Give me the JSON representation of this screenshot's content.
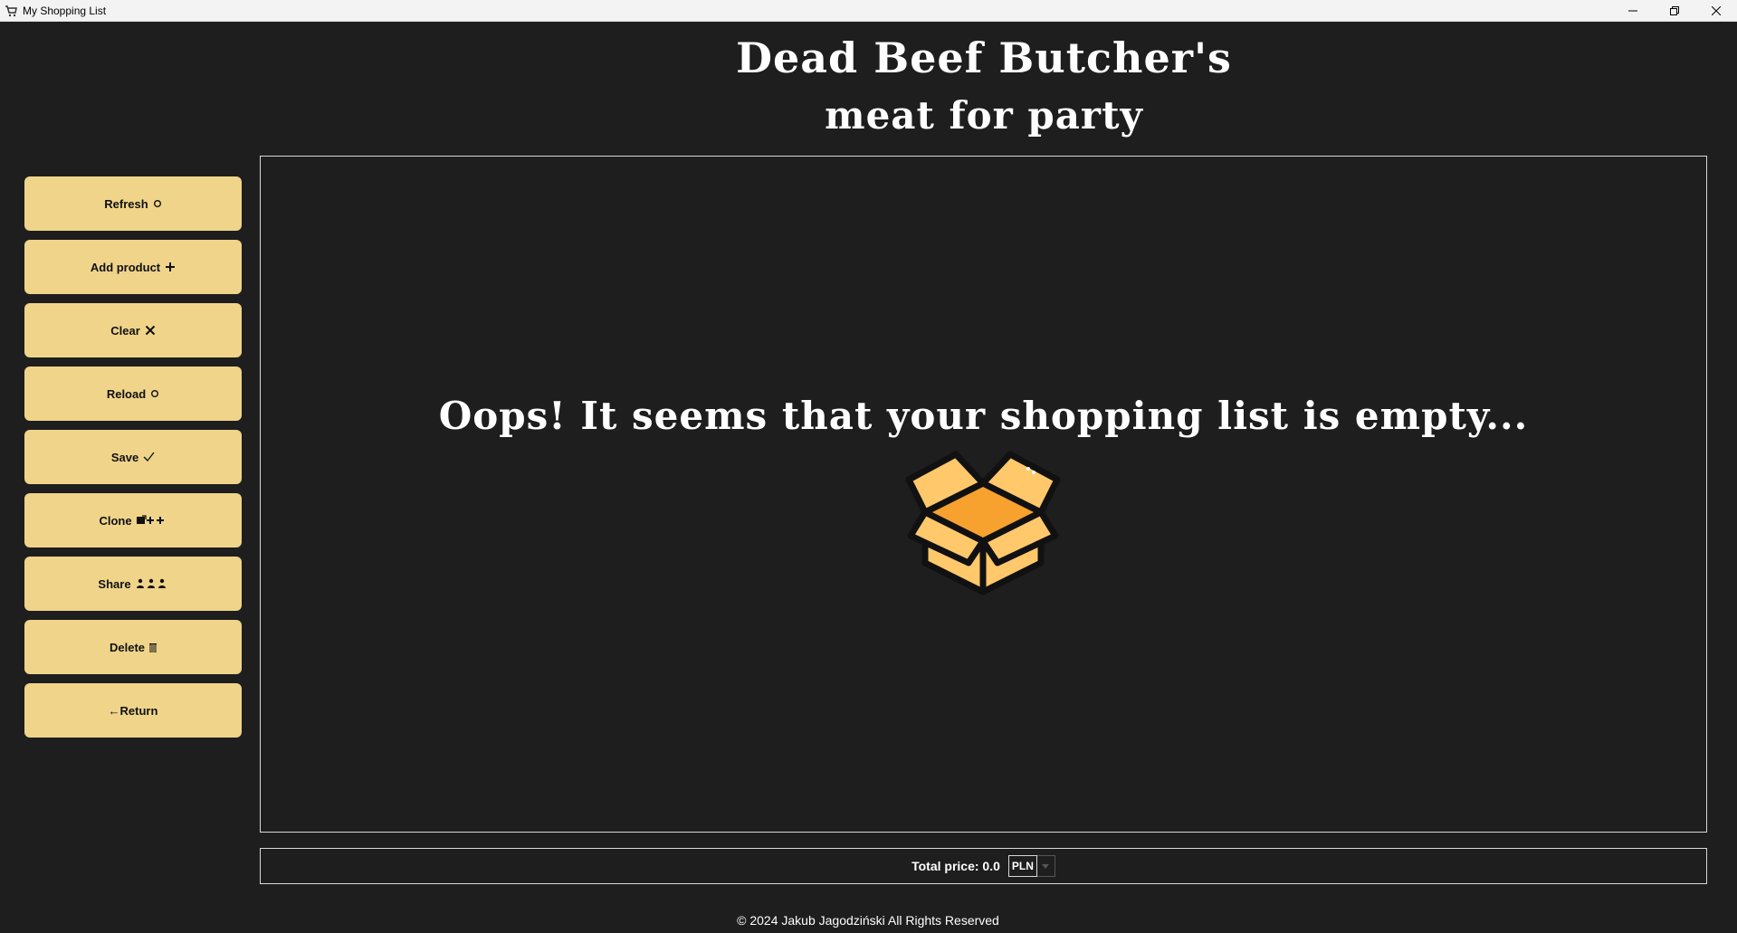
{
  "window": {
    "title": "My Shopping List"
  },
  "header": {
    "line1": "Dead Beef Butcher's",
    "line2": "meat for party"
  },
  "sidebar": {
    "buttons": [
      {
        "label": "Refresh",
        "icon": "refresh-icon"
      },
      {
        "label": "Add product",
        "icon": "plus-icon"
      },
      {
        "label": "Clear",
        "icon": "x-icon"
      },
      {
        "label": "Reload",
        "icon": "reload-icon"
      },
      {
        "label": "Save",
        "icon": "checkmark-icon"
      },
      {
        "label": "Clone",
        "icon": "clone-icon"
      },
      {
        "label": "Share",
        "icon": "people-icon"
      },
      {
        "label": "Delete",
        "icon": "trash-icon"
      },
      {
        "label": "←Return",
        "icon": ""
      }
    ]
  },
  "main": {
    "empty_message": "Oops! It seems that your shopping list is empty..."
  },
  "total": {
    "label": "Total price: 0.0",
    "currency": "PLN"
  },
  "footer": {
    "text": "© 2024 Jakub Jagodziński All Rights Reserved"
  },
  "colors": {
    "background": "#1e1e1e",
    "button": "#efd48a",
    "box_dark": "#f7a12f",
    "box_light": "#ffc86b"
  }
}
